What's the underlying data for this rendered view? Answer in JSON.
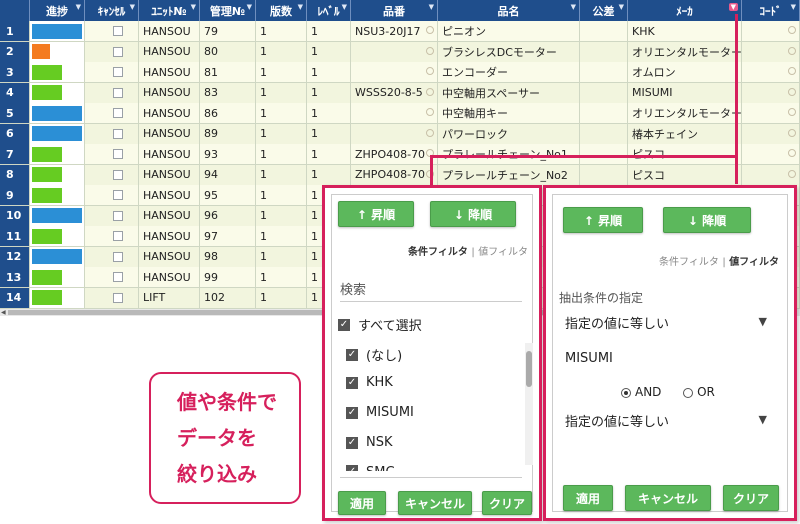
{
  "grid": {
    "columns": [
      {
        "label": "",
        "w": 30
      },
      {
        "label": "進捗",
        "w": 55
      },
      {
        "label": "ｷｬﾝｾﾙ",
        "w": 54
      },
      {
        "label": "ﾕﾆｯﾄ№",
        "w": 61
      },
      {
        "label": "管理№",
        "w": 56
      },
      {
        "label": "版数",
        "w": 51
      },
      {
        "label": "ﾚﾍﾞﾙ",
        "w": 44
      },
      {
        "label": "品番",
        "w": 87
      },
      {
        "label": "品名",
        "w": 142
      },
      {
        "label": "公差",
        "w": 48
      },
      {
        "label": "ﾒｰｶ",
        "w": 114
      },
      {
        "label": "ｺｰﾄﾞ",
        "w": 58
      }
    ],
    "rows": [
      {
        "no": "1",
        "progress": 1.0,
        "color": "#2b8fd6",
        "unit": "HANSOU",
        "kanri": "79",
        "hansu": "1",
        "level": "1",
        "hinban": "NSU3-20J17",
        "hinmei": "ピニオン",
        "maker": "KHK"
      },
      {
        "no": "2",
        "progress": 0.35,
        "color": "#f47b20",
        "unit": "HANSOU",
        "kanri": "80",
        "hansu": "1",
        "level": "1",
        "hinban": "",
        "hinmei": "ブラシレスDCモーター",
        "maker": "オリエンタルモーター"
      },
      {
        "no": "3",
        "progress": 0.6,
        "color": "#66cc22",
        "unit": "HANSOU",
        "kanri": "81",
        "hansu": "1",
        "level": "1",
        "hinban": "",
        "hinmei": "エンコーダー",
        "maker": "オムロン"
      },
      {
        "no": "4",
        "progress": 0.6,
        "color": "#66cc22",
        "unit": "HANSOU",
        "kanri": "83",
        "hansu": "1",
        "level": "1",
        "hinban": "WSSS20-8-5",
        "hinmei": "中空軸用スペーサー",
        "maker": "MISUMI"
      },
      {
        "no": "5",
        "progress": 1.0,
        "color": "#2b8fd6",
        "unit": "HANSOU",
        "kanri": "86",
        "hansu": "1",
        "level": "1",
        "hinban": "",
        "hinmei": "中空軸用キー",
        "maker": "オリエンタルモーター"
      },
      {
        "no": "6",
        "progress": 1.0,
        "color": "#2b8fd6",
        "unit": "HANSOU",
        "kanri": "89",
        "hansu": "1",
        "level": "1",
        "hinban": "",
        "hinmei": "パワーロック",
        "maker": "椿本チェイン"
      },
      {
        "no": "7",
        "progress": 0.6,
        "color": "#66cc22",
        "unit": "HANSOU",
        "kanri": "93",
        "hansu": "1",
        "level": "1",
        "hinban": "ZHPO408-70",
        "hinmei": "プラレールチェーン_No1",
        "maker": "ピスコ"
      },
      {
        "no": "8",
        "progress": 0.6,
        "color": "#66cc22",
        "unit": "HANSOU",
        "kanri": "94",
        "hansu": "1",
        "level": "1",
        "hinban": "ZHPO408-70",
        "hinmei": "プラレールチェーン_No2",
        "maker": "ピスコ"
      },
      {
        "no": "9",
        "progress": 0.6,
        "color": "#66cc22",
        "unit": "HANSOU",
        "kanri": "95",
        "hansu": "1",
        "level": "1",
        "hinban": "",
        "hinmei": "",
        "maker": ""
      },
      {
        "no": "10",
        "progress": 1.0,
        "color": "#2b8fd6",
        "unit": "HANSOU",
        "kanri": "96",
        "hansu": "1",
        "level": "1",
        "hinban": "",
        "hinmei": "",
        "maker": ""
      },
      {
        "no": "11",
        "progress": 0.6,
        "color": "#66cc22",
        "unit": "HANSOU",
        "kanri": "97",
        "hansu": "1",
        "level": "1",
        "hinban": "",
        "hinmei": "",
        "maker": ""
      },
      {
        "no": "12",
        "progress": 1.0,
        "color": "#2b8fd6",
        "unit": "HANSOU",
        "kanri": "98",
        "hansu": "1",
        "level": "1",
        "hinban": "",
        "hinmei": "",
        "maker": ""
      },
      {
        "no": "13",
        "progress": 0.6,
        "color": "#66cc22",
        "unit": "HANSOU",
        "kanri": "99",
        "hansu": "1",
        "level": "1",
        "hinban": "",
        "hinmei": "",
        "maker": ""
      },
      {
        "no": "14",
        "progress": 0.6,
        "color": "#66cc22",
        "unit": "LIFT",
        "kanri": "102",
        "hansu": "1",
        "level": "1",
        "hinban": "",
        "hinmei": "",
        "maker": ""
      }
    ]
  },
  "value_filter": {
    "asc": "↑ 昇順",
    "desc": "↓ 降順",
    "tab_condition": "条件フィルタ",
    "tab_sep": "|",
    "tab_value": "値フィルタ",
    "search_label": "検索",
    "items": [
      {
        "label": "すべて選択",
        "checked": true
      },
      {
        "label": "(なし)",
        "checked": true
      },
      {
        "label": "KHK",
        "checked": true
      },
      {
        "label": "MISUMI",
        "checked": true
      },
      {
        "label": "NSK",
        "checked": true
      },
      {
        "label": "SMC",
        "checked": true
      }
    ],
    "apply": "適用",
    "cancel": "キャンセル",
    "clear": "クリア"
  },
  "condition_filter": {
    "asc": "↑ 昇順",
    "desc": "↓ 降順",
    "tab_condition": "条件フィルタ",
    "tab_sep": "|",
    "tab_value": "値フィルタ",
    "heading": "抽出条件の指定",
    "cond1": "指定の値に等しい",
    "value1": "MISUMI",
    "and_label": "AND",
    "or_label": "OR",
    "cond2": "指定の値に等しい",
    "apply": "適用",
    "cancel": "キャンセル",
    "clear": "クリア"
  },
  "callout": {
    "line1": "値や条件で",
    "line2": "データを",
    "line3": "絞り込み"
  }
}
